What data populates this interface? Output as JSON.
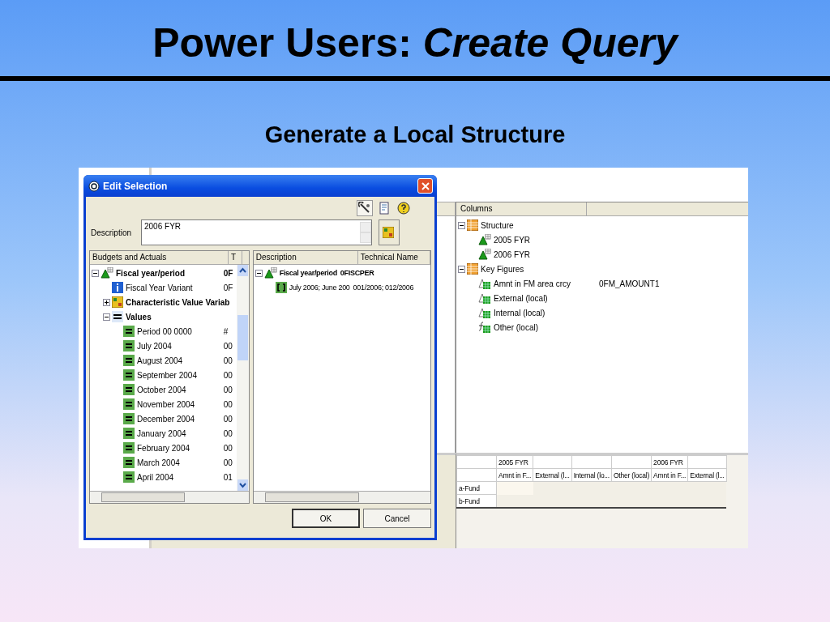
{
  "title": {
    "main": "Power Users:",
    "emphasis": "Create Query"
  },
  "subtitle": "Generate a Local Structure",
  "query_designer": {
    "columns_panel": {
      "header": "Columns",
      "items": [
        {
          "label": "Structure",
          "kind": "structure",
          "expanded": true,
          "children": [
            {
              "label": "2005 FYR",
              "kind": "characteristic"
            },
            {
              "label": "2006 FYR",
              "kind": "characteristic"
            }
          ]
        },
        {
          "label": "Key Figures",
          "kind": "structure",
          "expanded": true,
          "children": [
            {
              "label": "Amnt in FM area crcy",
              "code": "0FM_AMOUNT1",
              "kind": "key_figure"
            },
            {
              "label": "External (local)",
              "kind": "key_figure"
            },
            {
              "label": "Internal (local)",
              "kind": "key_figure"
            },
            {
              "label": "Other (local)",
              "kind": "formula"
            }
          ]
        }
      ]
    },
    "preview_grid": {
      "header_rows": [
        [
          "",
          "2005 FYR",
          "",
          "",
          "",
          "2006 FYR",
          ""
        ],
        [
          "",
          "Amnt in F...",
          "External (l...",
          "Internal (lo...",
          "Other (local)",
          "Amnt in F...",
          "External (l..."
        ]
      ],
      "rows": [
        "a-Fund",
        "b-Fund"
      ]
    }
  },
  "dialog": {
    "title": "Edit Selection",
    "description_label": "Description",
    "description_value": "2006 FYR",
    "left_pane": {
      "columns": [
        "Budgets and Actuals",
        "T"
      ],
      "items": [
        {
          "label": "Fiscal year/period",
          "code": "0F",
          "kind": "characteristic",
          "bold": true,
          "expanded": true,
          "children": [
            {
              "label": "Fiscal Year Variant",
              "code": "0F",
              "kind": "info",
              "bold": false
            },
            {
              "label": "Characteristic Value Variab",
              "kind": "variable",
              "bold": true,
              "expanded": false
            },
            {
              "label": "Values",
              "kind": "values",
              "bold": true,
              "expanded": true,
              "children": [
                {
                  "label": "Period 00 0000",
                  "code": "#",
                  "kind": "value",
                  "bold": false
                },
                {
                  "label": "July 2004",
                  "code": "00",
                  "kind": "value",
                  "bold": false
                },
                {
                  "label": "August 2004",
                  "code": "00",
                  "kind": "value",
                  "bold": false
                },
                {
                  "label": "September 2004",
                  "code": "00",
                  "kind": "value",
                  "bold": false
                },
                {
                  "label": "October 2004",
                  "code": "00",
                  "kind": "value",
                  "bold": false
                },
                {
                  "label": "November 2004",
                  "code": "00",
                  "kind": "value",
                  "bold": false
                },
                {
                  "label": "December 2004",
                  "code": "00",
                  "kind": "value",
                  "bold": false
                },
                {
                  "label": "January 2004",
                  "code": "00",
                  "kind": "value",
                  "bold": false
                },
                {
                  "label": "February 2004",
                  "code": "00",
                  "kind": "value",
                  "bold": false
                },
                {
                  "label": "March 2004",
                  "code": "00",
                  "kind": "value",
                  "bold": false
                },
                {
                  "label": "April 2004",
                  "code": "01",
                  "kind": "value",
                  "bold": false
                }
              ]
            }
          ]
        }
      ]
    },
    "right_pane": {
      "columns": [
        "Description",
        "Technical Name"
      ],
      "items": [
        {
          "label": "Fiscal year/period",
          "code": "0FISCPER",
          "kind": "characteristic",
          "bold": true,
          "expanded": true,
          "children": [
            {
              "label": "July 2006; June 200",
              "code": "001/2006; 012/2006",
              "kind": "range",
              "bold": false
            }
          ]
        }
      ]
    },
    "buttons": [
      "OK",
      "Cancel"
    ]
  }
}
